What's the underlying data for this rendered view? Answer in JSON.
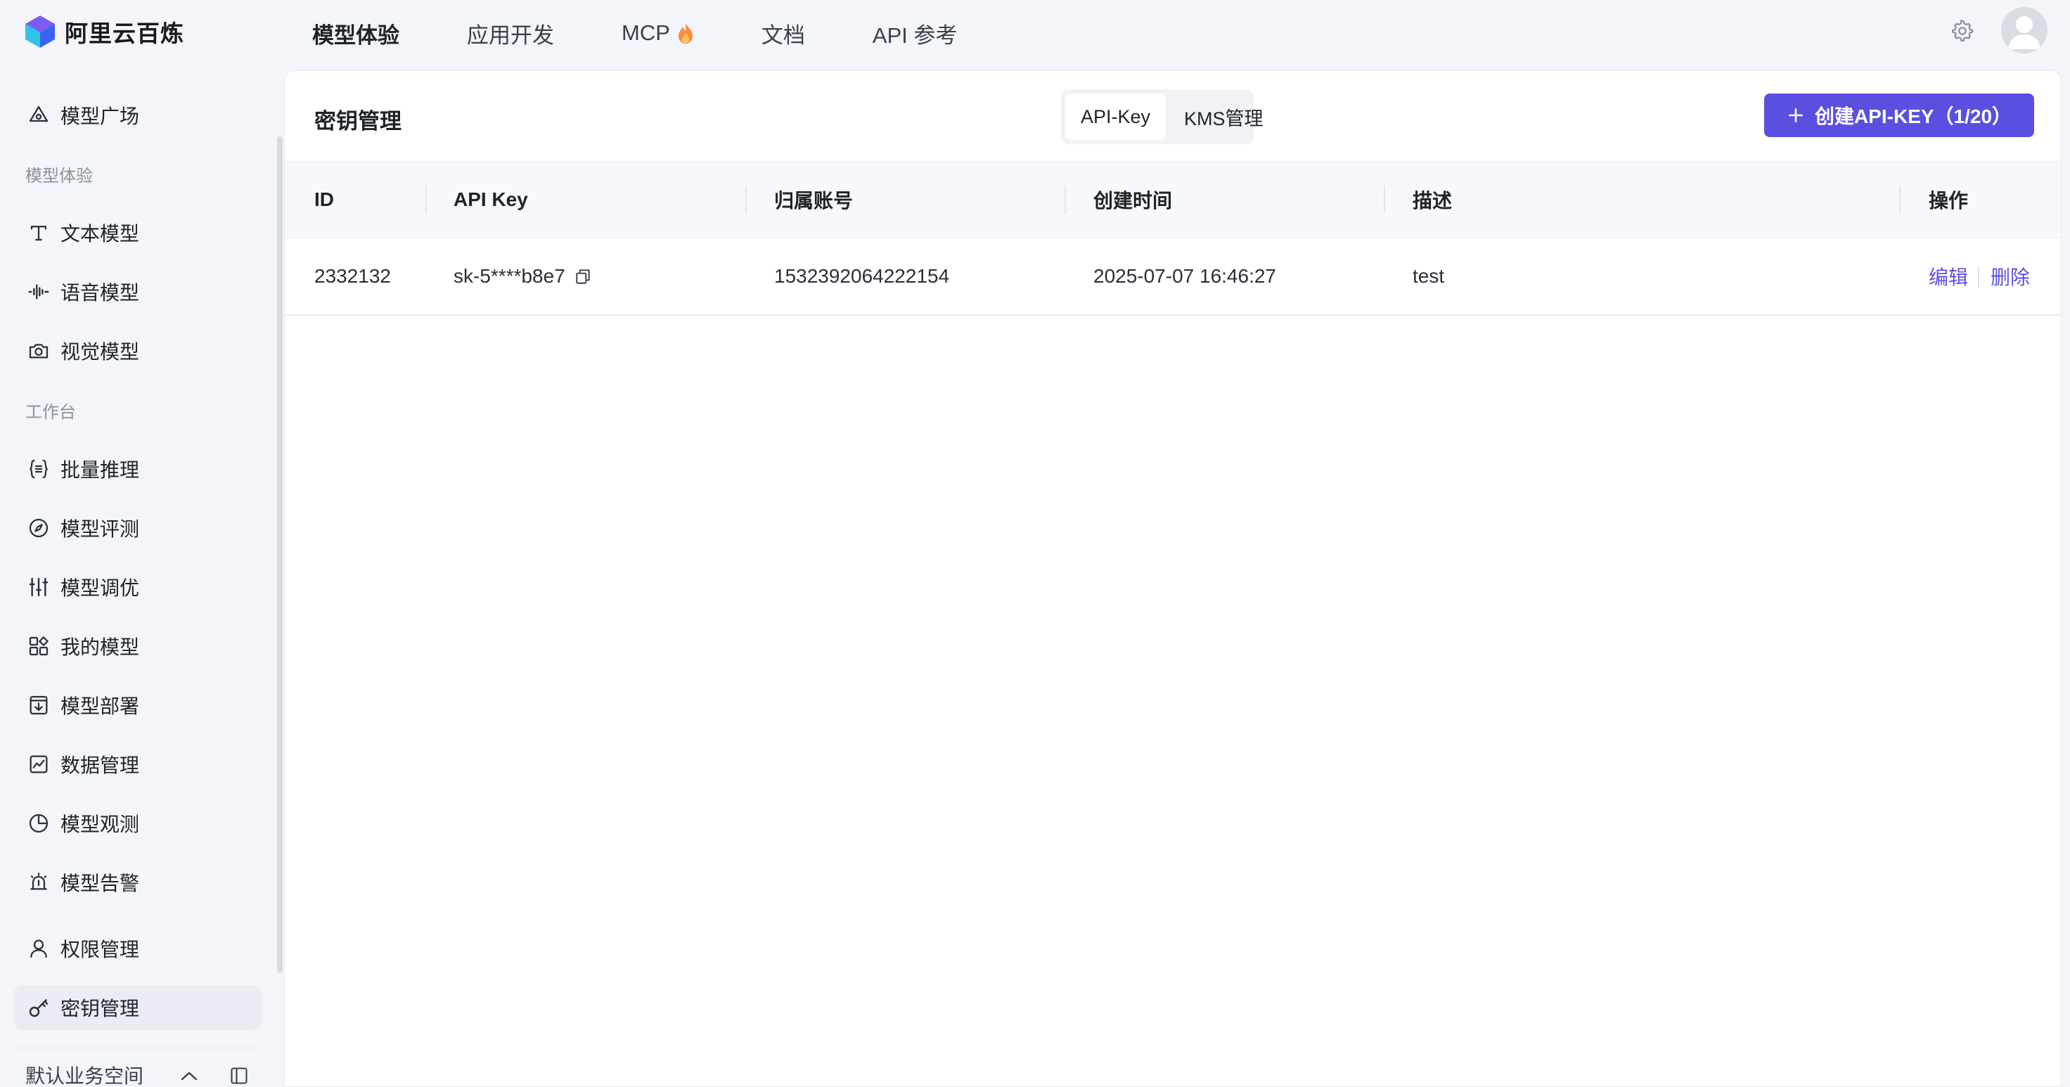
{
  "brand": {
    "title": "阿里云百炼"
  },
  "topnav": {
    "items": [
      {
        "label": "模型体验",
        "active": true
      },
      {
        "label": "应用开发",
        "active": false
      },
      {
        "label": "MCP",
        "active": false
      },
      {
        "label": "文档",
        "active": false
      },
      {
        "label": "API 参考",
        "active": false
      }
    ]
  },
  "sidebar": {
    "top_item": {
      "label": "模型广场",
      "icon": "model-plaza-icon"
    },
    "group1_label": "模型体验",
    "group1": [
      {
        "label": "文本模型",
        "icon": "text-icon"
      },
      {
        "label": "语音模型",
        "icon": "audio-wave-icon"
      },
      {
        "label": "视觉模型",
        "icon": "camera-icon"
      }
    ],
    "group2_label": "工作台",
    "group2": [
      {
        "label": "批量推理",
        "icon": "braces-icon"
      },
      {
        "label": "模型评测",
        "icon": "compass-icon"
      },
      {
        "label": "模型调优",
        "icon": "sliders-icon"
      },
      {
        "label": "我的模型",
        "icon": "apps-icon"
      },
      {
        "label": "模型部署",
        "icon": "deploy-icon"
      },
      {
        "label": "数据管理",
        "icon": "chart-icon"
      },
      {
        "label": "模型观测",
        "icon": "pie-icon"
      },
      {
        "label": "模型告警",
        "icon": "alarm-icon"
      }
    ],
    "group3": [
      {
        "label": "权限管理",
        "icon": "user-icon"
      },
      {
        "label": "密钥管理",
        "icon": "key-icon",
        "active": true
      }
    ],
    "workspace_label": "默认业务空间"
  },
  "main": {
    "title": "密钥管理",
    "tabs": [
      {
        "label": "API-Key",
        "active": true
      },
      {
        "label": "KMS管理",
        "active": false
      }
    ],
    "create_button": "创建API-KEY（1/20）",
    "columns": [
      "ID",
      "API Key",
      "归属账号",
      "创建时间",
      "描述",
      "操作"
    ],
    "rows": [
      {
        "id": "2332132",
        "api_key": "sk-5****b8e7",
        "account": "1532392064222154",
        "created": "2025-07-07 16:46:27",
        "desc": "test",
        "actions": [
          "编辑",
          "删除"
        ]
      }
    ]
  },
  "colors": {
    "accent": "#5b4fe0",
    "background": "#f4f5fa",
    "panel": "#ffffff"
  }
}
